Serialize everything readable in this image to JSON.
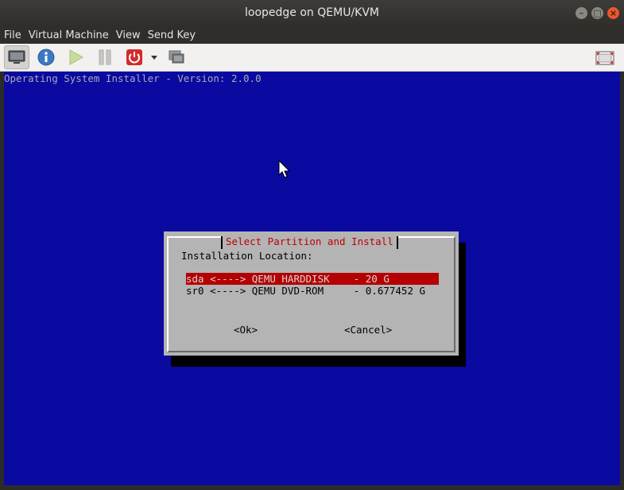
{
  "window": {
    "title": "loopedge on QEMU/KVM"
  },
  "menubar": {
    "items": [
      "File",
      "Virtual Machine",
      "View",
      "Send Key"
    ]
  },
  "toolbar": {
    "icons": [
      "monitor-icon",
      "info-icon",
      "play-icon",
      "pause-icon",
      "power-icon",
      "dropdown-arrow-icon",
      "snapshot-icon",
      "fullscreen-icon"
    ]
  },
  "installer": {
    "header": "Operating System Installer - Version: 2.0.0",
    "dialog_title": "Select Partition and Install",
    "location_label": "Installation Location:",
    "options": [
      {
        "text": "sda <----> QEMU HARDDISK    - 20 G",
        "selected": true
      },
      {
        "text": "sr0 <----> QEMU DVD-ROM     - 0.677452 G",
        "selected": false
      }
    ],
    "ok_label": "<Ok>",
    "cancel_label": "<Cancel>"
  },
  "colors": {
    "screen_bg": "#0a09a0",
    "dialog_bg": "#b4b4b4",
    "selection_bg": "#b40000",
    "title_text": "#c00000"
  }
}
